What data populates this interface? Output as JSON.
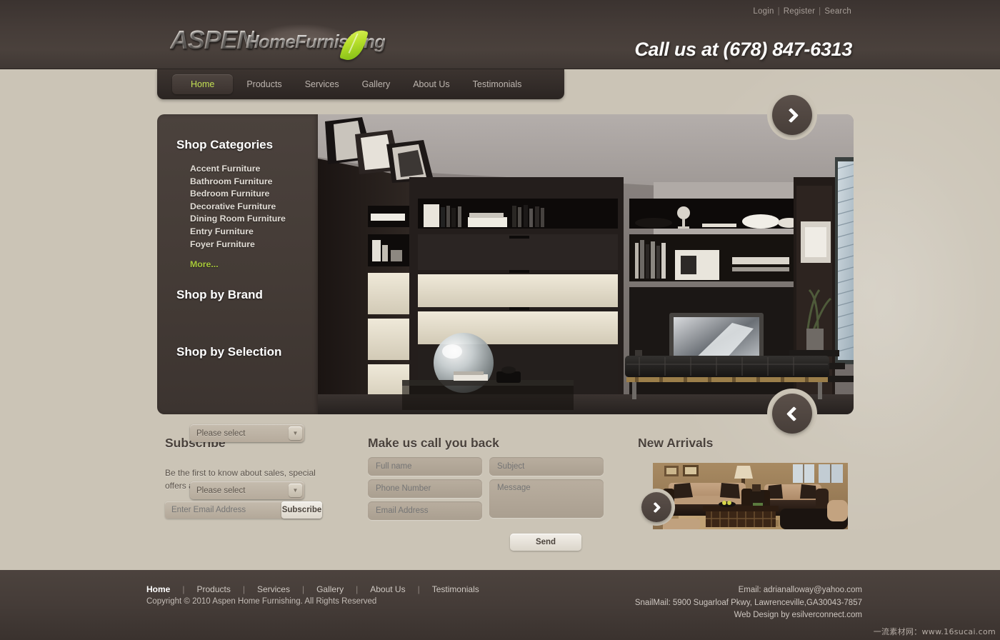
{
  "header": {
    "top_links": [
      {
        "label": "Login"
      },
      {
        "label": "Register"
      },
      {
        "label": "Search"
      }
    ],
    "separator": "|",
    "logo": {
      "brand_primary": "ASPEN",
      "brand_secondary": "HomeFurnishing",
      "leaf_icon": "leaf-icon"
    },
    "phone": "Call us at (678) 847-6313"
  },
  "nav": {
    "items": [
      {
        "label": "Home",
        "active": true
      },
      {
        "label": "Products",
        "active": false
      },
      {
        "label": "Services",
        "active": false
      },
      {
        "label": "Gallery",
        "active": false
      },
      {
        "label": "About Us",
        "active": false
      },
      {
        "label": "Testimonials",
        "active": false
      }
    ]
  },
  "sidebar": {
    "categories_title": "Shop Categories",
    "categories": [
      {
        "label": "Accent Furniture"
      },
      {
        "label": "Bathroom Furniture"
      },
      {
        "label": "Bedroom Furniture"
      },
      {
        "label": "Decorative Furniture"
      },
      {
        "label": "Dining Room Furniture"
      },
      {
        "label": "Entry Furniture"
      },
      {
        "label": "Foyer Furniture"
      }
    ],
    "more_label": "More...",
    "brand_title": "Shop by Brand",
    "brand_select_value": "Please select",
    "selection_title": "Shop by Selection",
    "selection_select_value": "Please select",
    "dropdown_icon": "chevron-down-icon"
  },
  "hero": {
    "next_icon": "chevron-right-icon",
    "prev_icon": "chevron-left-icon",
    "image_alt": "modern dark living room with wall unit, TV, glass sphere and black daybed"
  },
  "subscribe": {
    "title": "Subscribe",
    "description": "Be the first to know about sales, special offers and new arrivals",
    "email_placeholder": "Enter Email Address",
    "button_label": "Subscribe"
  },
  "callback": {
    "title": "Make us call you back",
    "fields": [
      {
        "placeholder": "Full name"
      },
      {
        "placeholder": "Phone Number"
      },
      {
        "placeholder": "Email Address"
      }
    ],
    "subject_placeholder": "Subject",
    "message_placeholder": "Message",
    "send_label": "Send"
  },
  "arrivals": {
    "title": "New Arrivals",
    "next_icon": "chevron-right-icon",
    "image_alt": "beige and dark brown sofa set with wooden coffee table"
  },
  "footer": {
    "nav": [
      {
        "label": "Home",
        "bold": true
      },
      {
        "label": "Products",
        "bold": false
      },
      {
        "label": "Services",
        "bold": false
      },
      {
        "label": "Gallery",
        "bold": false
      },
      {
        "label": "About Us",
        "bold": false
      },
      {
        "label": "Testimonials",
        "bold": false
      }
    ],
    "separator": "|",
    "copyright": "Copyright © 2010 Aspen Home Furnishing. All Rights Reserved",
    "email_line": "Email: adrianalloway@yahoo.com",
    "mail_line": "SnailMail: 5900 Sugarloaf Pkwy, Lawrenceville,GA30043-7857",
    "credit_line": "Web Design by esilverconnect.com"
  },
  "watermark": "一流素材网：www.16sucai.com",
  "colors": {
    "page_bg": "#cbc4b6",
    "header_bg": "#453c38",
    "accent_green": "#c3e053",
    "more_green": "#a8c93a",
    "footer_bg": "#453c38"
  }
}
